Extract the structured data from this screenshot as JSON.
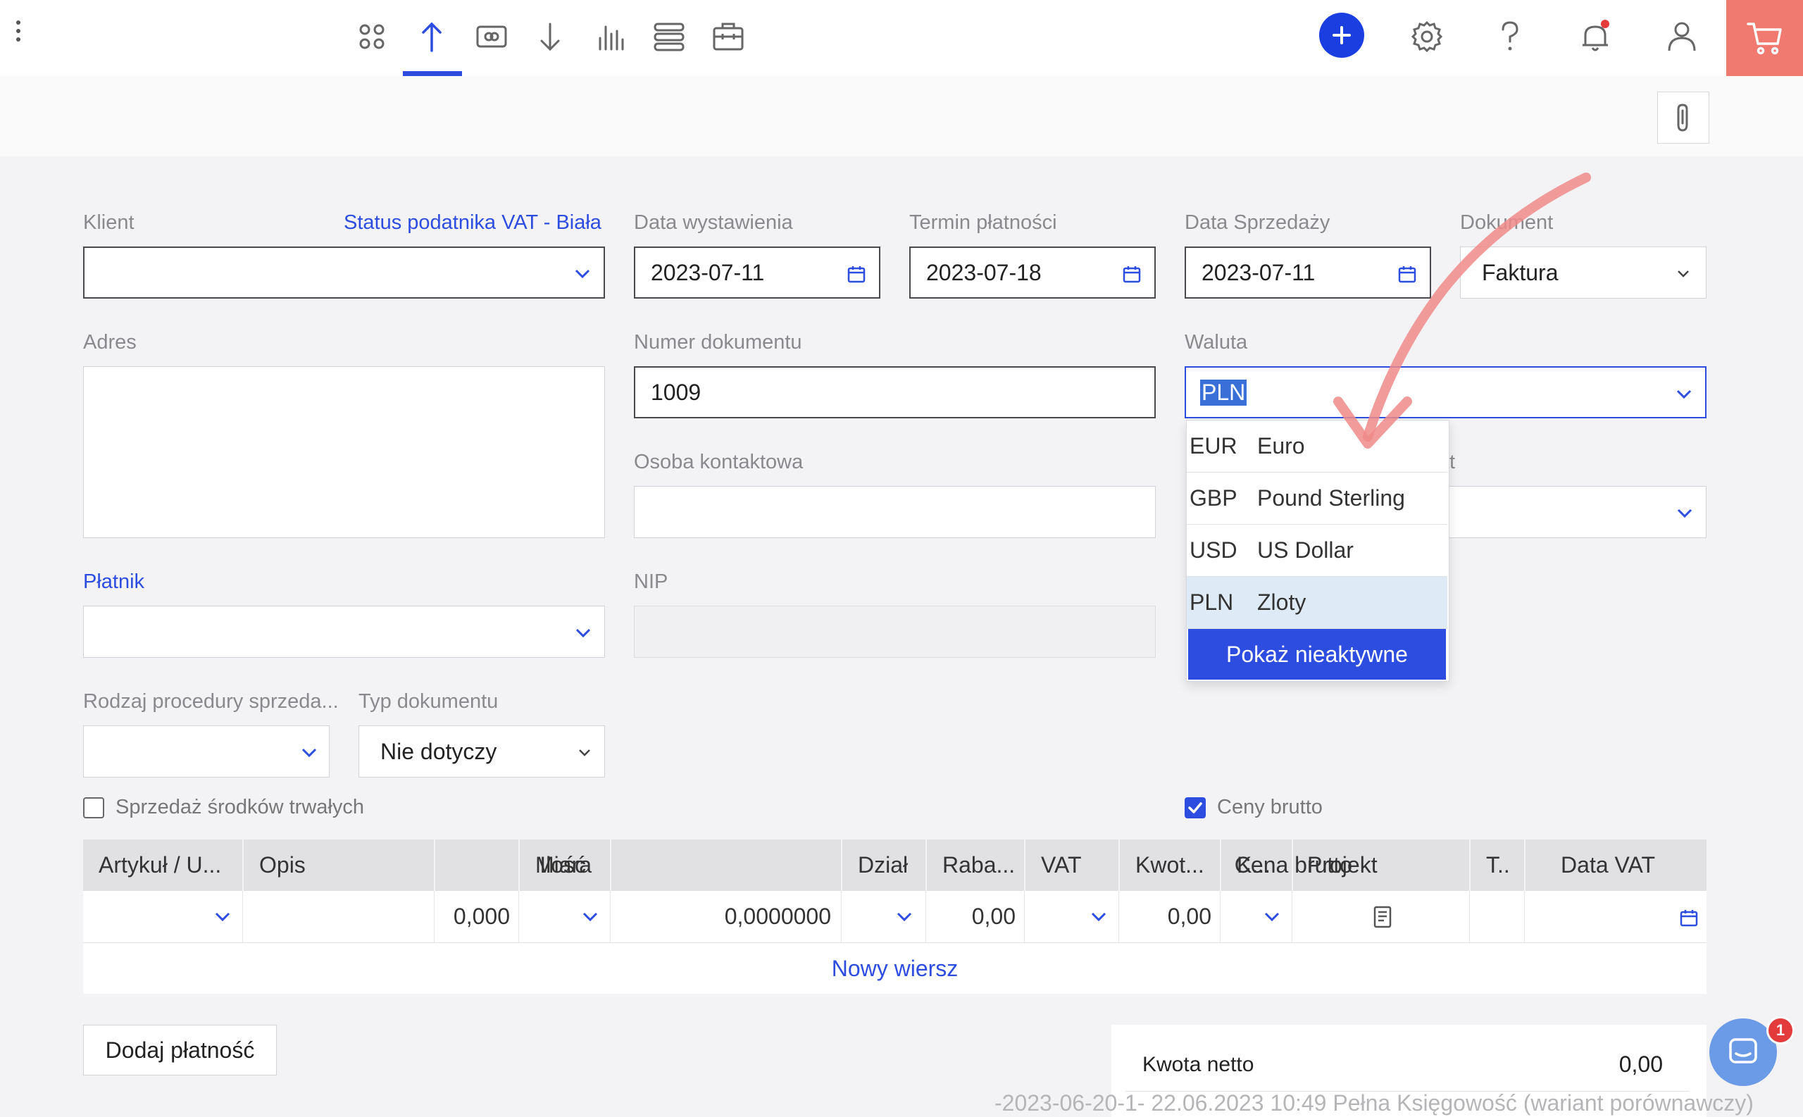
{
  "topbar": {
    "icons": [
      "dashboard-icon",
      "income-icon",
      "money-icon",
      "expense-icon",
      "reports-icon",
      "list-icon",
      "briefcase-icon"
    ],
    "active_icon": "income-icon",
    "notification_dot_color": "#e33b3b",
    "cart_color": "#f07a6f"
  },
  "form": {
    "client_label": "Klient",
    "vat_status_link": "Status podatnika VAT - Biała",
    "issue_date_label": "Data wystawienia",
    "issue_date": "2023-07-11",
    "payment_due_label": "Termin płatności",
    "payment_due": "2023-07-18",
    "sale_date_label": "Data Sprzedaży",
    "sale_date": "2023-07-11",
    "document_label": "Dokument",
    "document_value": "Faktura",
    "address_label": "Adres",
    "doc_number_label": "Numer dokumentu",
    "doc_number": "1009",
    "currency_label": "Waluta",
    "currency_value": "PLN",
    "contact_label": "Osoba kontaktowa",
    "project_label_partial": "t",
    "payer_label": "Płatnik",
    "nip_label": "NIP",
    "procedure_label": "Rodzaj procedury sprzeda...",
    "doc_type_label": "Typ dokumentu",
    "doc_type_value": "Nie dotyczy",
    "fixed_assets_label": "Sprzedaż środków trwałych",
    "gross_prices_label": "Ceny brutto"
  },
  "currency_dropdown": {
    "options": [
      {
        "code": "EUR",
        "name": "Euro"
      },
      {
        "code": "GBP",
        "name": "Pound Sterling"
      },
      {
        "code": "USD",
        "name": "US Dollar"
      },
      {
        "code": "PLN",
        "name": "Zloty"
      }
    ],
    "selected": "PLN",
    "show_inactive_label": "Pokaż nieaktywne"
  },
  "table": {
    "headers": [
      "Artykuł / U...",
      "Opis",
      "Ilość",
      "Miara",
      "Cena brutto",
      "Dział",
      "Raba...",
      "VAT",
      "Kwot...",
      "K...",
      "Projekt",
      "T..",
      "Data VAT"
    ],
    "row": {
      "quantity": "0,000",
      "gross_price": "0,0000000",
      "discount": "0,00",
      "amount": "0,00"
    },
    "new_row_label": "Nowy wiersz"
  },
  "add_payment_label": "Dodaj płatność",
  "summary": {
    "net_label": "Kwota netto",
    "net_value": "0,00"
  },
  "watermark": "-2023-06-20-1- 22.06.2023 10:49 Pełna Księgowość (wariant porównawczy)",
  "chat": {
    "badge": "1"
  }
}
